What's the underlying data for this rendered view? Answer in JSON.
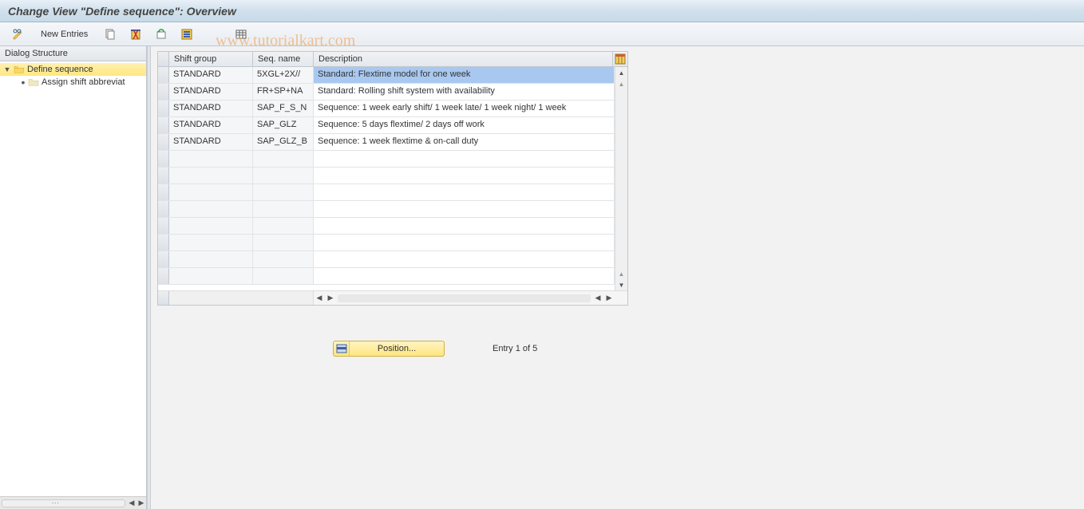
{
  "title": "Change View \"Define sequence\": Overview",
  "watermark": "www.tutorialkart.com",
  "toolbar": {
    "new_entries": "New Entries"
  },
  "dialog_structure": {
    "header": "Dialog Structure",
    "root": "Define sequence",
    "child": "Assign shift abbreviat"
  },
  "grid": {
    "columns": {
      "shift_group": "Shift group",
      "seq_name": "Seq. name",
      "description": "Description"
    },
    "rows": [
      {
        "group": "STANDARD",
        "name": "5XGL+2X//",
        "desc": "Standard: Flextime model for one week",
        "selected": true
      },
      {
        "group": "STANDARD",
        "name": "FR+SP+NA",
        "desc": "Standard: Rolling shift system with availability",
        "selected": false
      },
      {
        "group": "STANDARD",
        "name": "SAP_F_S_N",
        "desc": "Sequence: 1 week early shift/ 1 week late/ 1 week night/ 1 week",
        "selected": false
      },
      {
        "group": "STANDARD",
        "name": "SAP_GLZ",
        "desc": "Sequence: 5 days flextime/ 2 days off work",
        "selected": false
      },
      {
        "group": "STANDARD",
        "name": "SAP_GLZ_B",
        "desc": "Sequence: 1 week flextime & on-call duty",
        "selected": false
      }
    ]
  },
  "position_button": "Position...",
  "entry_status": "Entry 1 of 5"
}
